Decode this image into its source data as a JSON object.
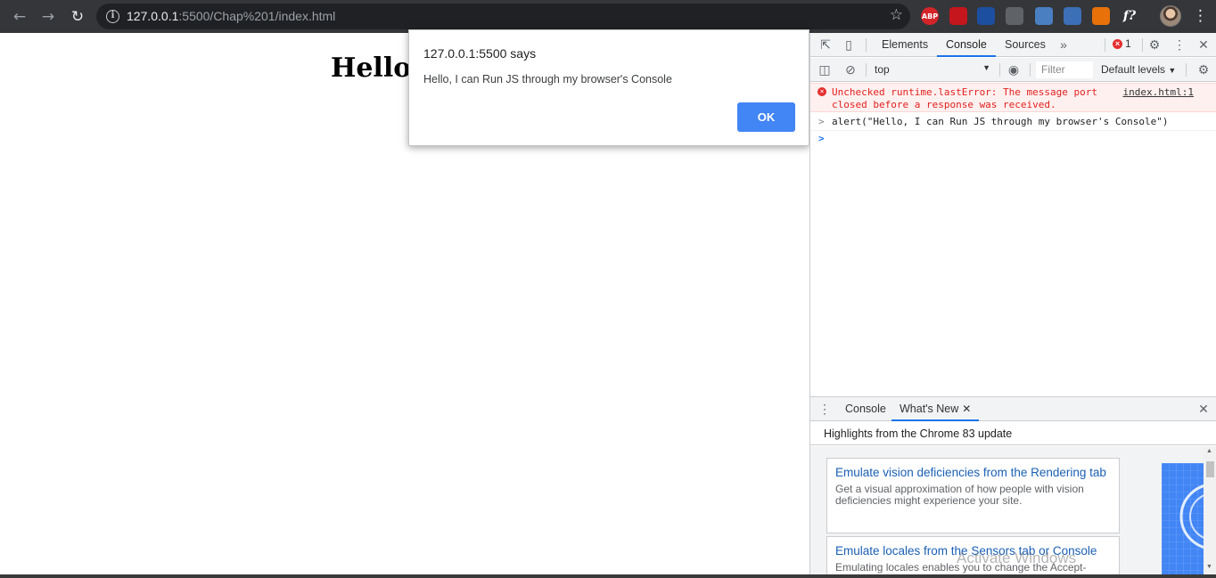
{
  "browser": {
    "url_host": "127.0.0.1",
    "url_rest": ":5500/Chap%201/index.html",
    "extensions": [
      {
        "name": "abp-icon",
        "label": "ABP",
        "color": "#d4242a"
      },
      {
        "name": "pdf-icon",
        "label": "",
        "color": "#c4161c"
      },
      {
        "name": "ext-blue-icon",
        "label": "",
        "color": "#1d4fa0"
      },
      {
        "name": "print-icon",
        "label": "",
        "color": "#5f6368"
      },
      {
        "name": "edit-icon",
        "label": "",
        "color": "#4a7fc1"
      },
      {
        "name": "ext-text-icon",
        "label": "",
        "color": "#3b6fb6"
      },
      {
        "name": "undo-icon",
        "label": "",
        "color": "#e8710a"
      },
      {
        "name": "function-icon",
        "label": "f?",
        "color": "#35363a"
      }
    ]
  },
  "page": {
    "heading": "Hello W"
  },
  "alert": {
    "title": "127.0.0.1:5500 says",
    "message": "Hello, I can Run JS through my browser's Console",
    "ok_label": "OK"
  },
  "devtools": {
    "tabs": [
      "Elements",
      "Console",
      "Sources"
    ],
    "active_tab": "Console",
    "more_tabs": "»",
    "error_count": "1",
    "context": "top",
    "filter_placeholder": "Filter",
    "levels": "Default levels",
    "error_message": "Unchecked runtime.lastError: The message port\nclosed before a response was received.",
    "error_source": "index.html:1",
    "command": "alert(\"Hello, I can Run JS through my browser's Console\")",
    "drawer": {
      "tabs": [
        "Console",
        "What's New"
      ],
      "active_tab": "What's New",
      "highlights": "Highlights from the Chrome 83 update",
      "cards": [
        {
          "title": "Emulate vision deficiencies from the Rendering tab",
          "description": "Get a visual approximation of how people with vision deficiencies might experience your site."
        },
        {
          "title": "Emulate locales from the Sensors tab or Console",
          "description": "Emulating locales enables you to change the Accept-"
        }
      ]
    }
  },
  "watermark": "Activate Windows",
  "colors": {
    "toolbar_bg": "#35363a",
    "omnibox_bg": "#202124",
    "ok_button": "#4285f4",
    "error_text": "#e0211d",
    "link": "#1a5fb4"
  }
}
